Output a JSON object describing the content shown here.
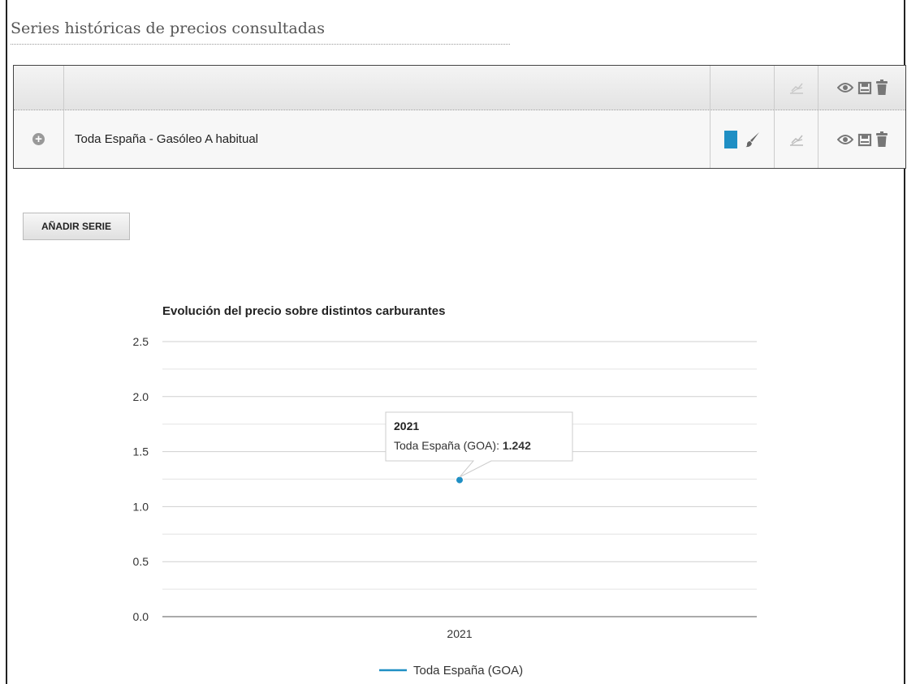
{
  "page": {
    "title": "Series históricas de precios consultadas"
  },
  "table": {
    "rows": [
      {
        "label": "Toda España - Gasóleo A habitual",
        "color": "#1f8fc4"
      }
    ],
    "icons": {
      "expand": "plus-circle-icon",
      "color_swatch": "color-swatch-icon",
      "edit": "paintbrush-icon",
      "chart_type": "line-chart-icon",
      "view": "eye-icon",
      "save": "save-icon",
      "delete": "trash-icon"
    }
  },
  "actions": {
    "add_series_label": "AÑADIR SERIE"
  },
  "chart_data": {
    "type": "line",
    "title": "Evolución del precio sobre distintos carburantes",
    "categories": [
      "2021"
    ],
    "series": [
      {
        "name": "Toda España (GOA)",
        "values": [
          1.242
        ],
        "color": "#1f8fc4"
      }
    ],
    "ylim": [
      0,
      2.5
    ],
    "yticks": [
      "0.0",
      "0.5",
      "1.0",
      "1.5",
      "2.0",
      "2.5"
    ],
    "grid": true,
    "legend": "bottom-center",
    "tooltip": {
      "header": "2021",
      "series_label": "Toda España (GOA)",
      "separator": ": ",
      "value": "1.242"
    }
  }
}
